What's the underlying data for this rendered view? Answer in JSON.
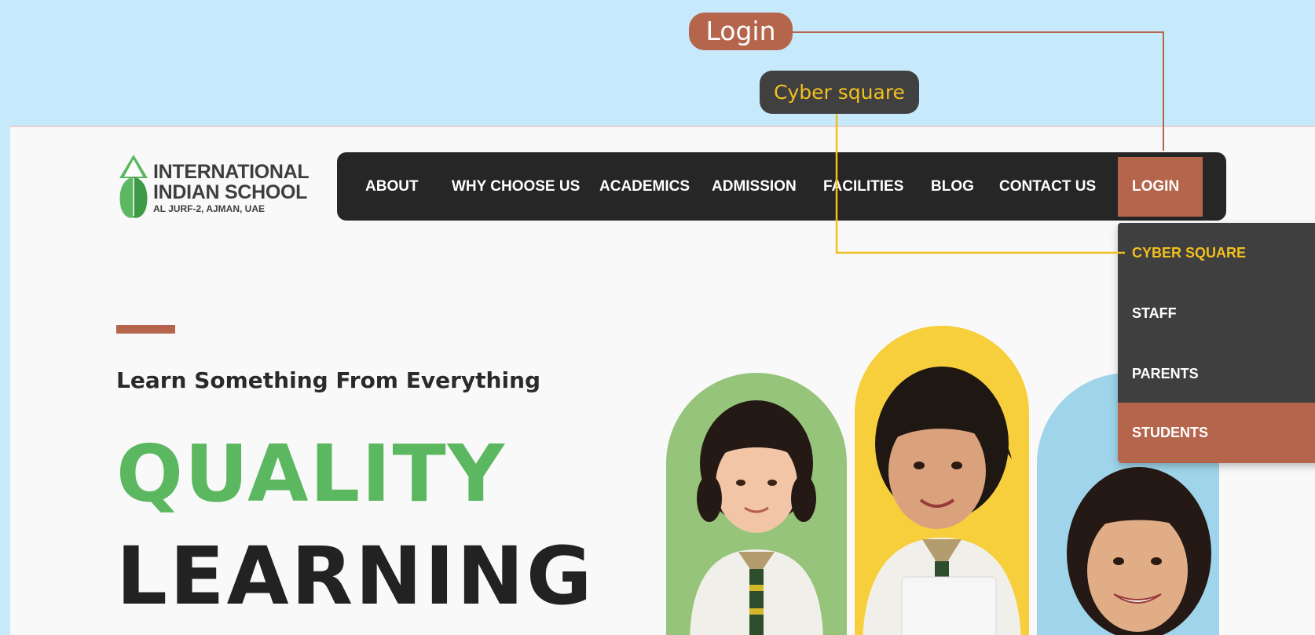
{
  "callouts": {
    "login": "Login",
    "cyber": "Cyber square"
  },
  "logo": {
    "line1": "INTERNATIONAL",
    "line2": "INDIAN SCHOOL",
    "line3": "AL JURF-2, AJMAN, UAE"
  },
  "nav": {
    "items": [
      "ABOUT",
      "WHY CHOOSE US",
      "ACADEMICS",
      "ADMISSION",
      "FACILITIES",
      "BLOG",
      "CONTACT US"
    ],
    "login": "LOGIN"
  },
  "dropdown": {
    "items": [
      "CYBER SQUARE",
      "STAFF",
      "PARENTS",
      "STUDENTS"
    ]
  },
  "hero": {
    "tagline": "Learn Something From Everything",
    "line1": "QUALITY",
    "line2": "LEARNING"
  },
  "colors": {
    "accent": "#b5654c",
    "highlight": "#f2c01e",
    "green": "#5bb760",
    "nav_bg": "#262626",
    "sky": "#c6e9fb"
  }
}
